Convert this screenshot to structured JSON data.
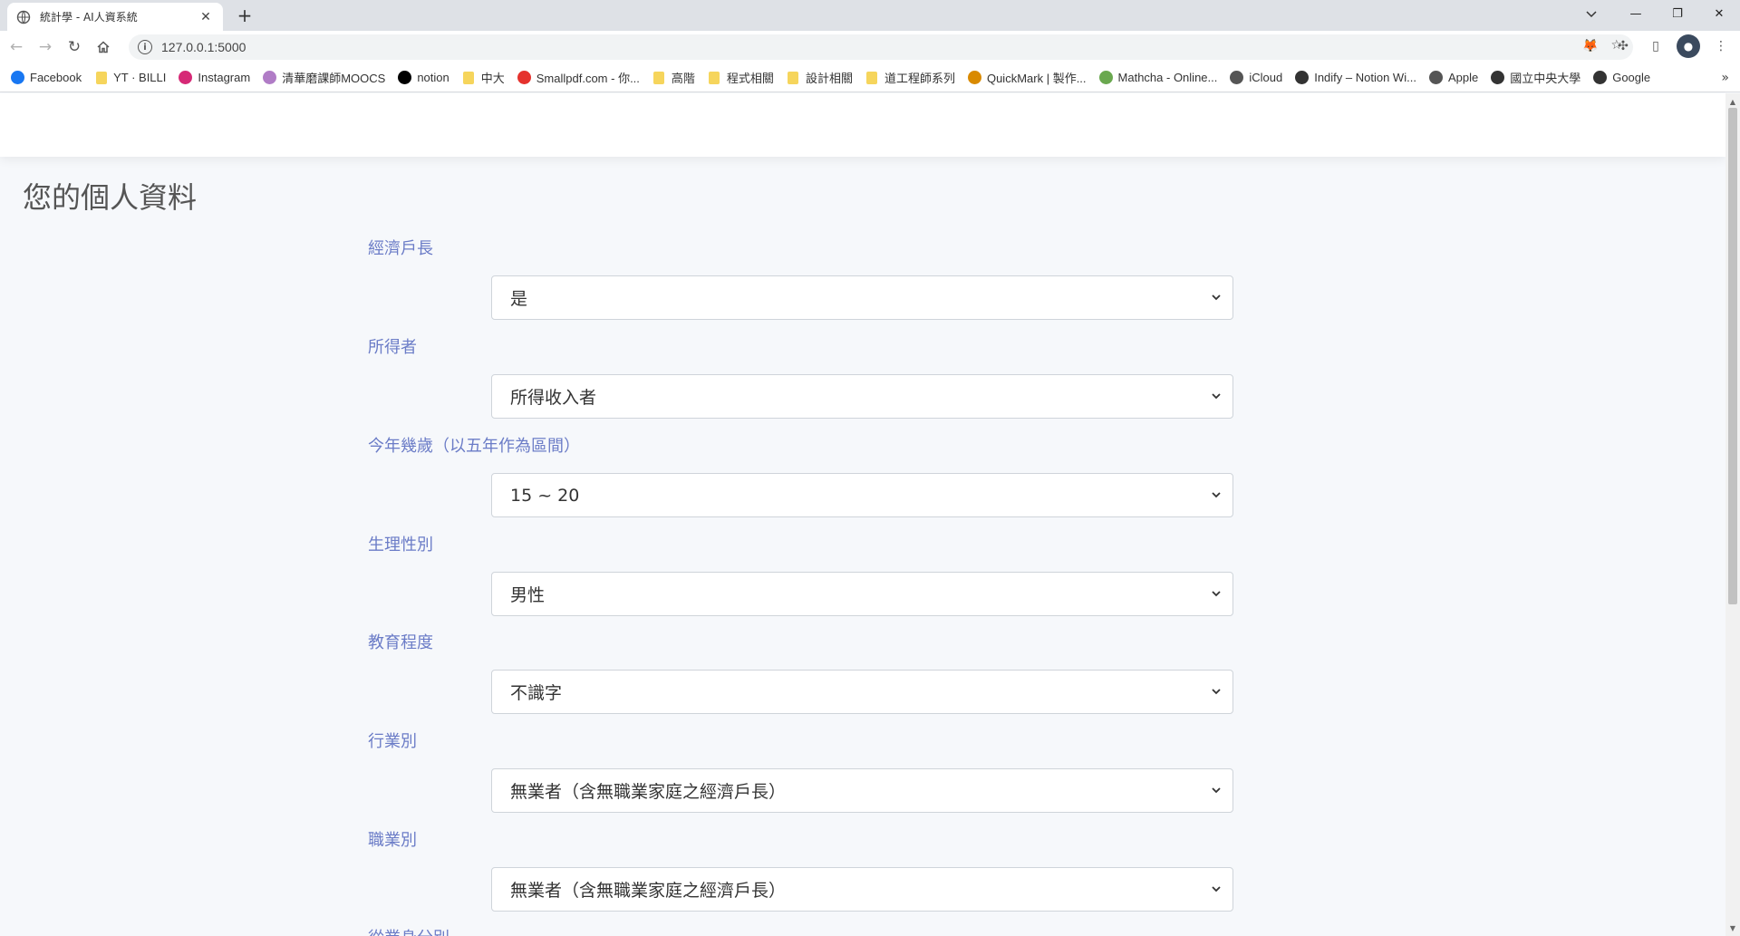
{
  "browser": {
    "tab_title": "統計學 - AI人資系統",
    "url": "127.0.0.1:5000",
    "bookmarks": [
      {
        "label": "Facebook",
        "icon": "facebook-icon",
        "color": "#1877f2"
      },
      {
        "label": "YT · BILLI",
        "icon": "folder-icon",
        "color": "#f6d55c"
      },
      {
        "label": "Instagram",
        "icon": "instagram-icon",
        "color": "#d62976"
      },
      {
        "label": "清華磨課師MOOCS",
        "icon": "moocs-icon",
        "color": "#b07cc6"
      },
      {
        "label": "notion",
        "icon": "notion-icon",
        "color": "#000000"
      },
      {
        "label": "中大",
        "icon": "folder-icon",
        "color": "#f6d55c"
      },
      {
        "label": "Smallpdf.com - 你...",
        "icon": "smallpdf-icon",
        "color": "#e5322d"
      },
      {
        "label": "高階",
        "icon": "folder-icon",
        "color": "#f6d55c"
      },
      {
        "label": "程式相關",
        "icon": "folder-icon",
        "color": "#f6d55c"
      },
      {
        "label": "設計相關",
        "icon": "folder-icon",
        "color": "#f6d55c"
      },
      {
        "label": "道工程師系列",
        "icon": "folder-icon",
        "color": "#f6d55c"
      },
      {
        "label": "QuickMark | 製作...",
        "icon": "quickmark-icon",
        "color": "#d98a00"
      },
      {
        "label": "Mathcha - Online...",
        "icon": "mathcha-icon",
        "color": "#6aa84f"
      },
      {
        "label": "iCloud",
        "icon": "apple-icon",
        "color": "#555555"
      },
      {
        "label": "Indify – Notion Wi...",
        "icon": "indify-icon",
        "color": "#333333"
      },
      {
        "label": "Apple",
        "icon": "apple-icon",
        "color": "#555555"
      },
      {
        "label": "國立中央大學",
        "icon": "globe-icon",
        "color": "#333333"
      },
      {
        "label": "Google",
        "icon": "globe-icon",
        "color": "#333333"
      }
    ]
  },
  "page": {
    "title": "您的個人資料",
    "fields": [
      {
        "label": "經濟戶長",
        "value": "是"
      },
      {
        "label": "所得者",
        "value": "所得收入者"
      },
      {
        "label": "今年幾歲（以五年作為區間）",
        "value": "15 ~ 20"
      },
      {
        "label": "生理性別",
        "value": "男性"
      },
      {
        "label": "教育程度",
        "value": "不識字"
      },
      {
        "label": "行業別",
        "value": "無業者（含無職業家庭之經濟戶長）"
      },
      {
        "label": "職業別",
        "value": "無業者（含無職業家庭之經濟戶長）"
      },
      {
        "label": "從業身分別",
        "value": ""
      }
    ]
  },
  "colors": {
    "label": "#6b7cc7",
    "page_background": "#f6f8fb"
  }
}
